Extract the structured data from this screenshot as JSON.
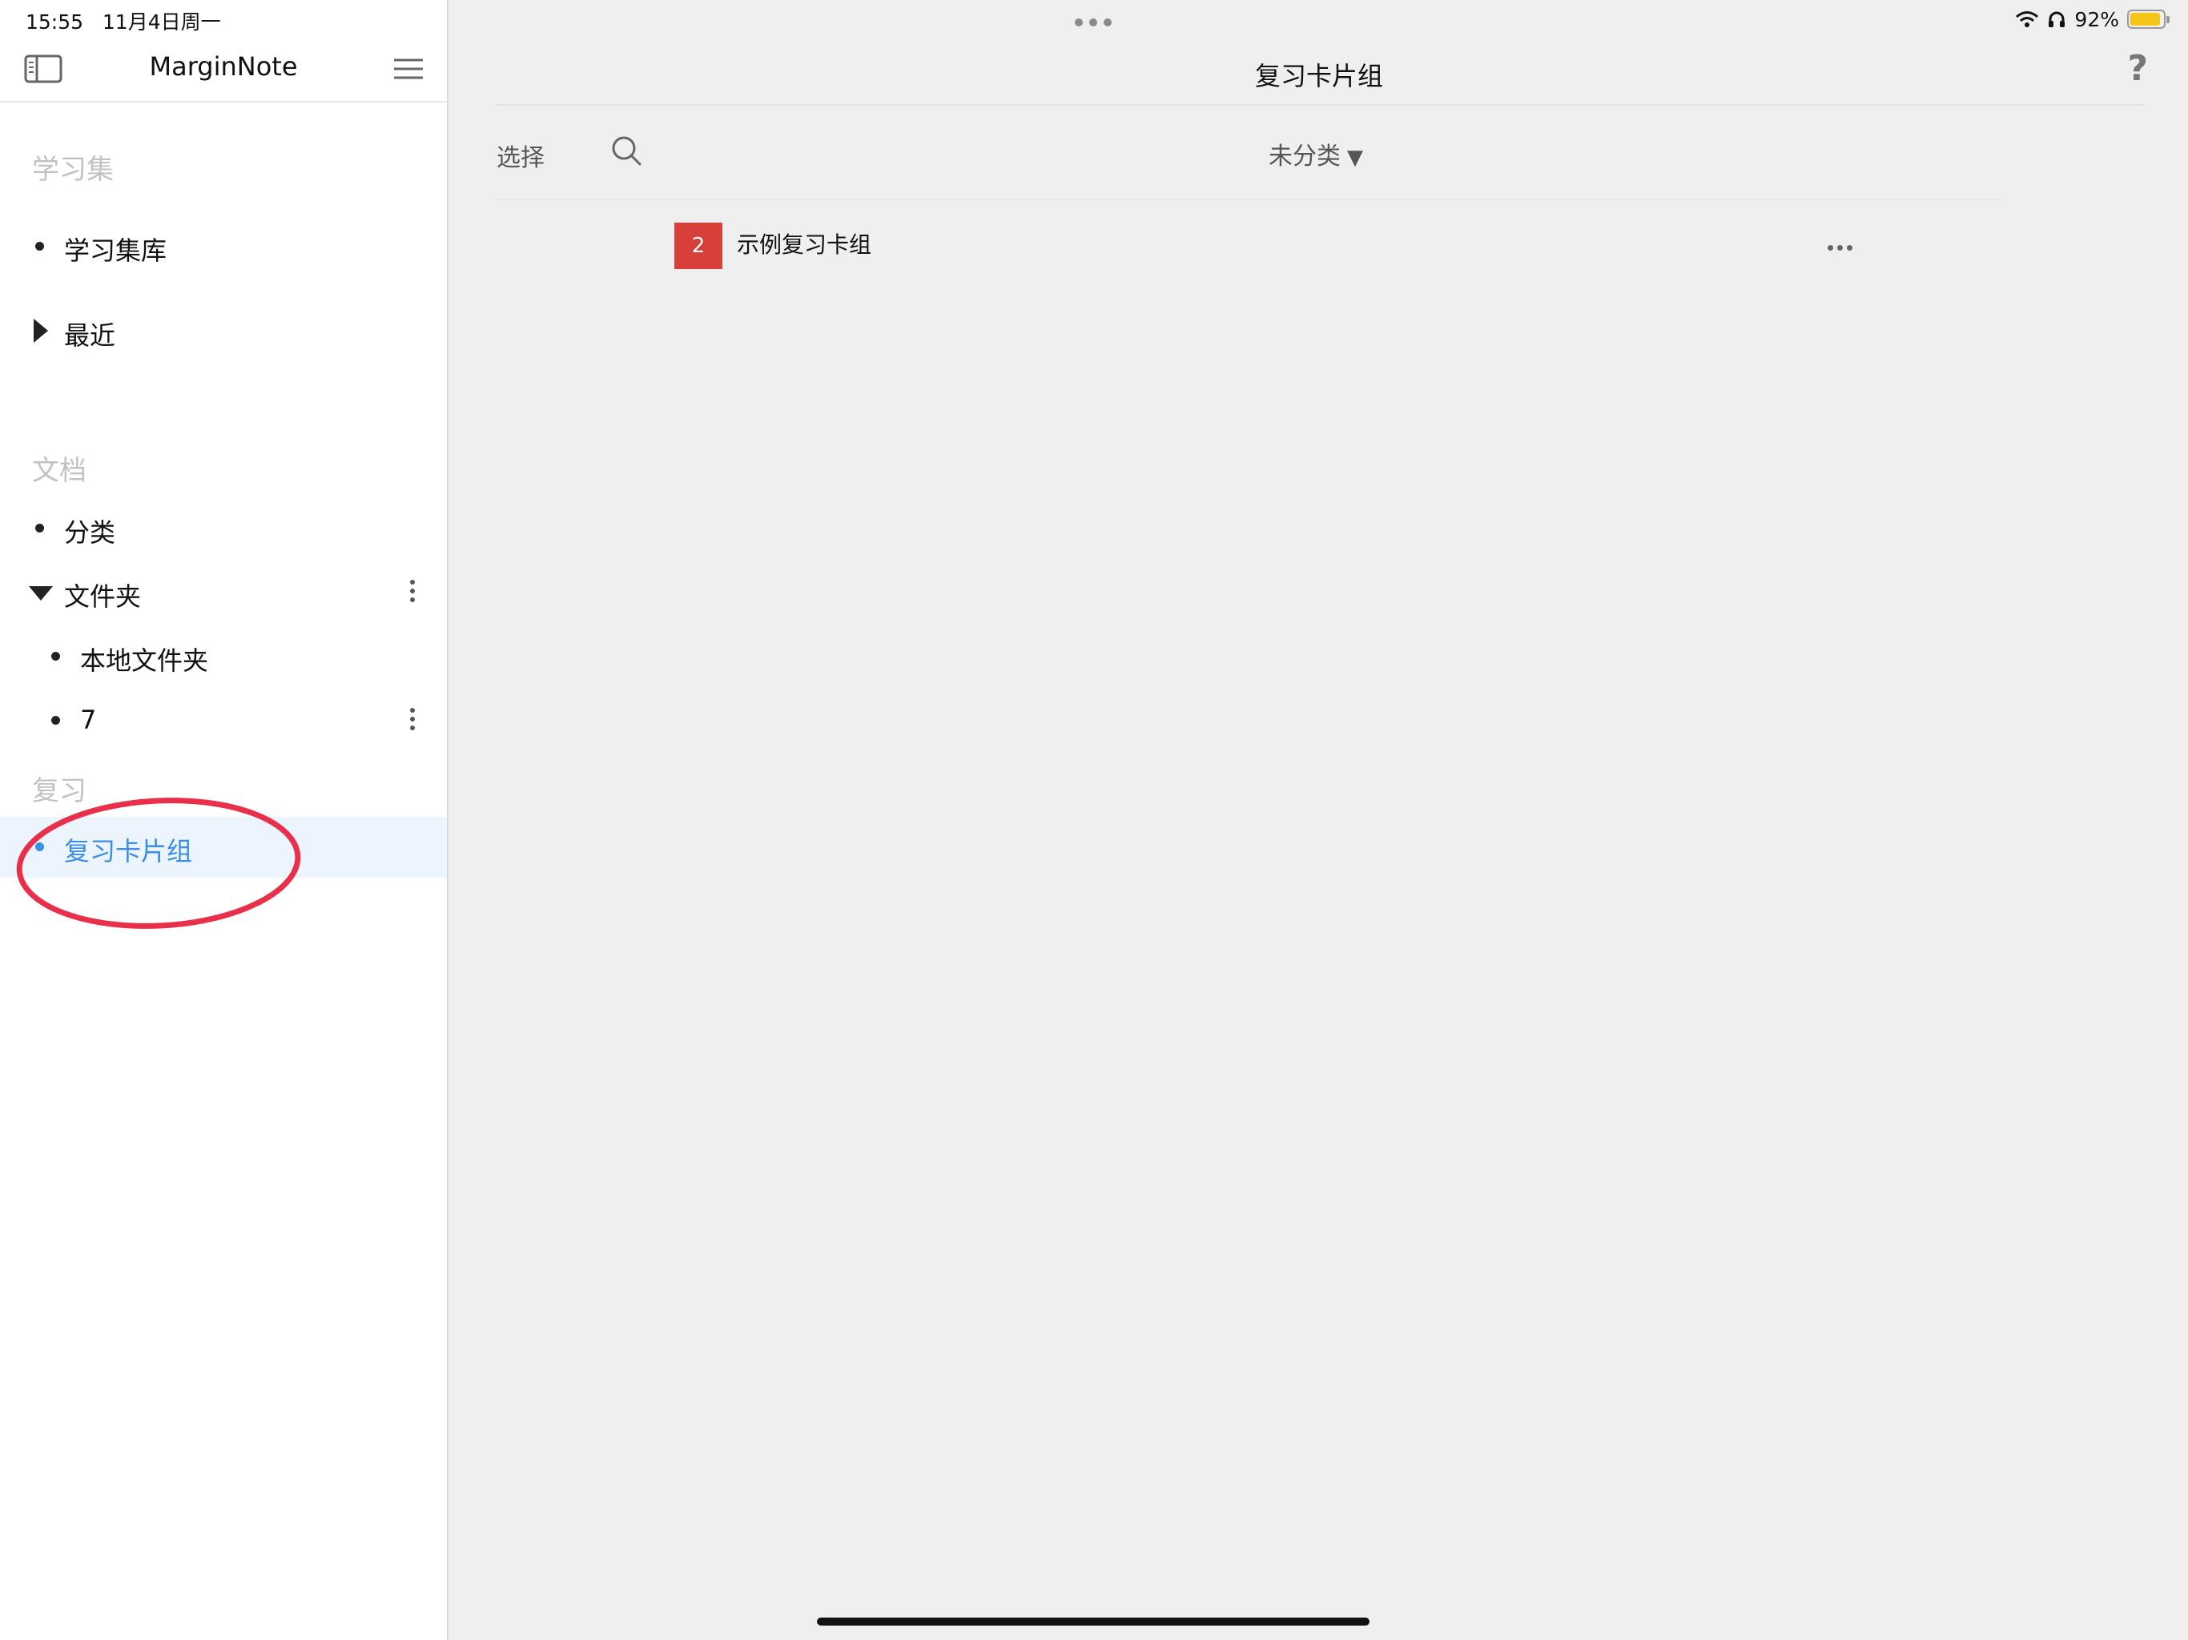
{
  "status_bar": {
    "time": "15:55",
    "date": "11月4日周一",
    "battery_percent": "92%",
    "battery_level": 0.92
  },
  "sidebar": {
    "app_title": "MarginNote",
    "sections": {
      "study": "学习集",
      "docs": "文档",
      "review": "复习"
    },
    "items": {
      "library": "学习集库",
      "recent": "最近",
      "categories": "分类",
      "folders": "文件夹",
      "local_folder": "本地文件夹",
      "folder_7": "7",
      "review_decks": "复习卡片组"
    }
  },
  "main": {
    "title": "复习卡片组",
    "help": "?",
    "select_label": "选择",
    "filter_label": "未分类",
    "filter_arrow": "▼",
    "decks": [
      {
        "count": "2",
        "name": "示例复习卡组"
      }
    ]
  },
  "colors": {
    "accent": "#3a8ee6",
    "badge": "#d7403a",
    "annotation": "#e8304a",
    "battery": "#f5c518"
  }
}
